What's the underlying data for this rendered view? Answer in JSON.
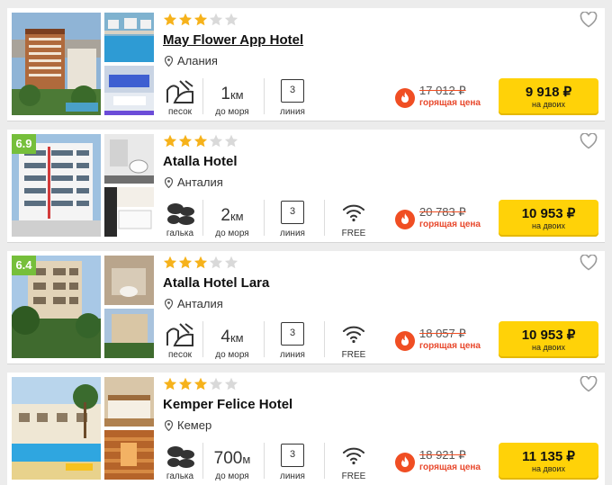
{
  "hotels": [
    {
      "rating": "",
      "stars": 3,
      "name": "May Flower App Hotel",
      "location": "Алания",
      "beach_type": "песок",
      "distance_value": "1",
      "distance_unit": "км",
      "distance_caption": "до моря",
      "line_value": "3",
      "line_caption": "линия",
      "wifi_label": "",
      "old_price": "17 012 ₽",
      "hot_label": "горящая цена",
      "price": "9 918 ₽",
      "price_note": "на двоих"
    },
    {
      "rating": "6.9",
      "stars": 3,
      "name": "Atalla Hotel",
      "location": "Анталия",
      "beach_type": "галька",
      "distance_value": "2",
      "distance_unit": "км",
      "distance_caption": "до моря",
      "line_value": "3",
      "line_caption": "линия",
      "wifi_label": "FREE",
      "old_price": "20 783 ₽",
      "hot_label": "горящая цена",
      "price": "10 953 ₽",
      "price_note": "на двоих"
    },
    {
      "rating": "6.4",
      "stars": 3,
      "name": "Atalla Hotel Lara",
      "location": "Анталия",
      "beach_type": "песок",
      "distance_value": "4",
      "distance_unit": "км",
      "distance_caption": "до моря",
      "line_value": "3",
      "line_caption": "линия",
      "wifi_label": "FREE",
      "old_price": "18 057 ₽",
      "hot_label": "горящая цена",
      "price": "10 953 ₽",
      "price_note": "на двоих"
    },
    {
      "rating": "",
      "stars": 3,
      "name": "Kemper Felice Hotel",
      "location": "Кемер",
      "beach_type": "галька",
      "distance_value": "700",
      "distance_unit": "м",
      "distance_caption": "до моря",
      "line_value": "3",
      "line_caption": "линия",
      "wifi_label": "FREE",
      "old_price": "18 921 ₽",
      "hot_label": "горящая цена",
      "price": "11 135 ₽",
      "price_note": "на двоих"
    }
  ],
  "colors": {
    "star_on": "#f6b21b",
    "star_off": "#d9d9d9",
    "rating_bg": "#76bf3b",
    "button": "#ffd208",
    "hot": "#e8482c"
  },
  "icons": [
    "star-icon",
    "heart-icon",
    "location-pin-icon",
    "sand-beach-icon",
    "pebble-beach-icon",
    "wifi-icon",
    "fire-icon"
  ]
}
